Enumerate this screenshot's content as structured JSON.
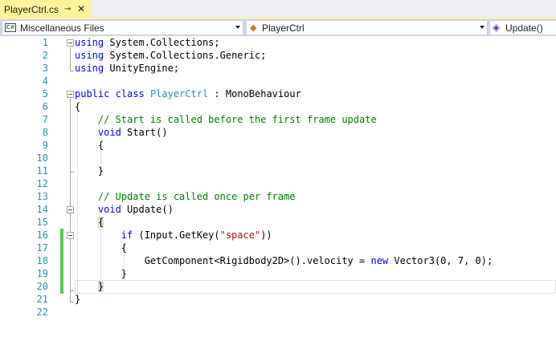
{
  "tab": {
    "label": "PlayerCtrl.cs",
    "pin_glyph": "⊸",
    "close_glyph": "✕"
  },
  "navbar": {
    "project": "Miscellaneous Files",
    "class_name": "PlayerCtrl",
    "member": "Update()",
    "cs_icon_text": "C#"
  },
  "line_numbers": [
    "1",
    "2",
    "3",
    "4",
    "5",
    "6",
    "7",
    "8",
    "9",
    "10",
    "11",
    "12",
    "13",
    "14",
    "15",
    "16",
    "17",
    "18",
    "19",
    "20",
    "21",
    "22"
  ],
  "code": {
    "l1": [
      "using",
      " System.Collections;"
    ],
    "l2": [
      "using",
      " System.Collections.Generic;"
    ],
    "l3": [
      "using",
      " UnityEngine;"
    ],
    "l5": [
      "public",
      " ",
      "class",
      " ",
      "PlayerCtrl",
      " : MonoBehaviour"
    ],
    "l6": "{",
    "l7": "    // Start is called before the first frame update",
    "l8": [
      "    ",
      "void",
      " Start()"
    ],
    "l9": "    {",
    "l11": "    }",
    "l13": "    // Update is called once per frame",
    "l14": [
      "    ",
      "void",
      " Update()"
    ],
    "l15": [
      "    ",
      "{"
    ],
    "l16": [
      "        ",
      "if",
      " (Input.GetKey(",
      "\"space\"",
      "))"
    ],
    "l17": "        {",
    "l18": [
      "            GetComponent<Rigidbody2D>().velocity = ",
      "new",
      " Vector3(0, 7, 0);"
    ],
    "l19": "        }",
    "l20": [
      "    ",
      "}"
    ],
    "l21": "}"
  }
}
